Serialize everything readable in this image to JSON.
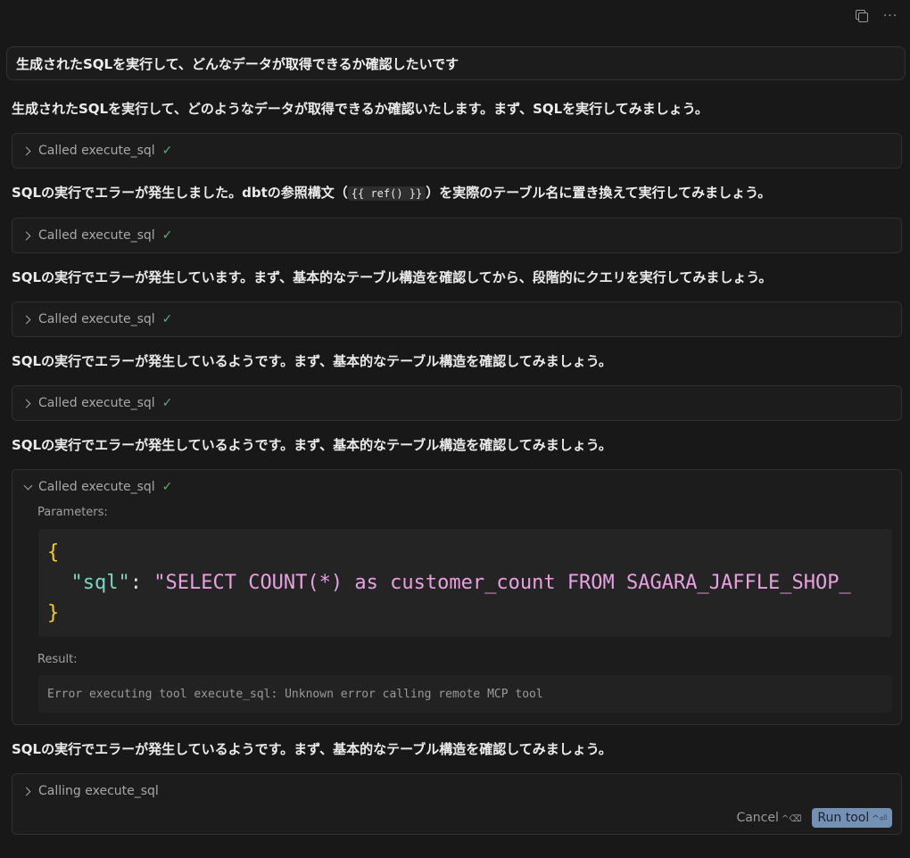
{
  "topbar": {
    "copy_icon": "copy-icon",
    "more_icon": "more-icon",
    "more_glyph": "···"
  },
  "user_message": "生成されたSQLを実行して、どんなデータが取得できるか確認したいです",
  "assistant": {
    "msg1": "生成されたSQLを実行して、どのようなデータが取得できるか確認いたします。まず、SQLを実行してみましょう。",
    "msg2_before": "SQLの実行でエラーが発生しました。dbtの参照構文（",
    "msg2_code": "{{ ref() }}",
    "msg2_after": "）を実際のテーブル名に置き換えて実行してみましょう。",
    "msg3": "SQLの実行でエラーが発生しています。まず、基本的なテーブル構造を確認してから、段階的にクエリを実行してみましょう。",
    "msg4": "SQLの実行でエラーが発生しているようです。まず、基本的なテーブル構造を確認してみましょう。",
    "msg5": "SQLの実行でエラーが発生しているようです。まず、基本的なテーブル構造を確認してみましょう。",
    "msg6": "SQLの実行でエラーが発生しているようです。まず、基本的なテーブル構造を確認してみましょう。"
  },
  "tool_calls": [
    {
      "label": "Called execute_sql",
      "status": "✓"
    },
    {
      "label": "Called execute_sql",
      "status": "✓"
    },
    {
      "label": "Called execute_sql",
      "status": "✓"
    },
    {
      "label": "Called execute_sql",
      "status": "✓"
    },
    {
      "label": "Called execute_sql",
      "status": "✓",
      "parameters_label": "Parameters:",
      "code": {
        "open": "{",
        "key": "\"sql\"",
        "colon": ": ",
        "value": "\"SELECT COUNT(*) as customer_count FROM SAGARA_JAFFLE_SHOP_",
        "close": "}"
      },
      "result_label": "Result:",
      "result": "Error executing tool execute_sql: Unknown error calling remote MCP tool"
    }
  ],
  "pending_call": {
    "label": "Calling execute_sql",
    "cancel_label": "Cancel",
    "cancel_shortcut": "^⌫",
    "run_label": "Run tool",
    "run_shortcut": "^⏎"
  },
  "colors": {
    "background": "#181818",
    "check": "#5fae7a",
    "run_button": "#7391b4",
    "json_brace": "#f5d20d",
    "json_key": "#7fd4c4",
    "json_string": "#e8a0e0"
  }
}
